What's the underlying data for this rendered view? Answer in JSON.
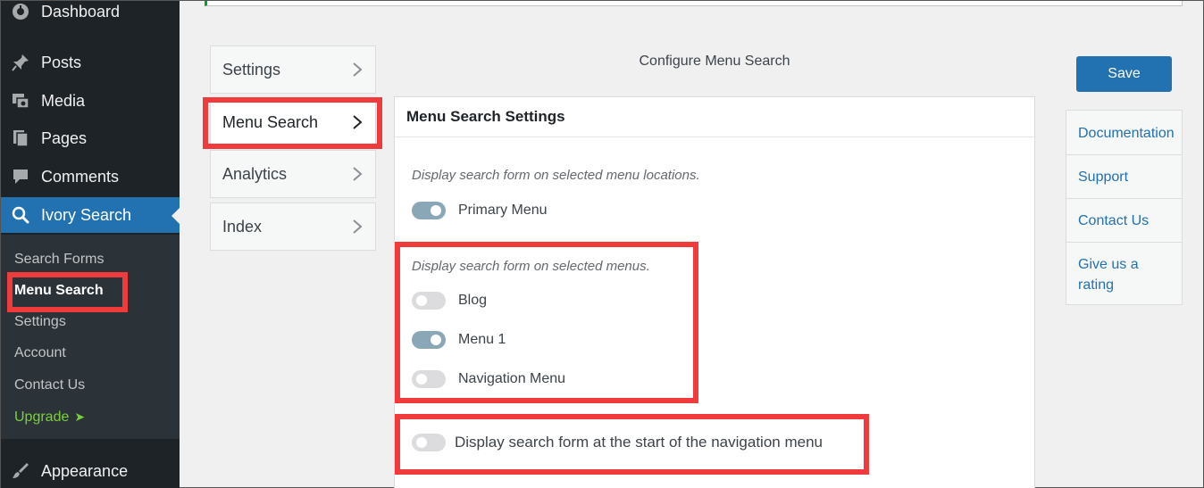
{
  "sidebar": {
    "items": [
      {
        "label": "Dashboard",
        "icon": "dashboard-icon"
      },
      {
        "label": "Posts",
        "icon": "pin-icon"
      },
      {
        "label": "Media",
        "icon": "media-icon"
      },
      {
        "label": "Pages",
        "icon": "pages-icon"
      },
      {
        "label": "Comments",
        "icon": "comments-icon"
      },
      {
        "label": "Ivory Search",
        "icon": "search-icon"
      },
      {
        "label": "Appearance",
        "icon": "brush-icon"
      }
    ],
    "submenu": [
      "Search Forms",
      "Menu Search",
      "Settings",
      "Account",
      "Contact Us",
      "Upgrade"
    ],
    "upgrade_arrow": "➤"
  },
  "tabs": [
    "Settings",
    "Menu Search",
    "Analytics",
    "Index"
  ],
  "main": {
    "heading": "Configure Menu Search",
    "panel_title": "Menu Search Settings",
    "locations_desc": "Display search form on selected menu locations.",
    "locations": [
      {
        "label": "Primary Menu",
        "on": true
      }
    ],
    "menus_desc": "Display search form on selected menus.",
    "menus": [
      {
        "label": "Blog",
        "on": false
      },
      {
        "label": "Menu 1",
        "on": true
      },
      {
        "label": "Navigation Menu",
        "on": false
      }
    ],
    "start_option": {
      "label": "Display search form at the start of the navigation menu",
      "on": false
    }
  },
  "right": {
    "save_label": "Save",
    "links": [
      "Documentation",
      "Support",
      "Contact Us",
      "Give us a rating"
    ]
  },
  "colors": {
    "accent": "#2271b1",
    "highlight": "#ef3b3b",
    "toggle_on": "#8aa7b8",
    "upgrade": "#7ad03a"
  }
}
